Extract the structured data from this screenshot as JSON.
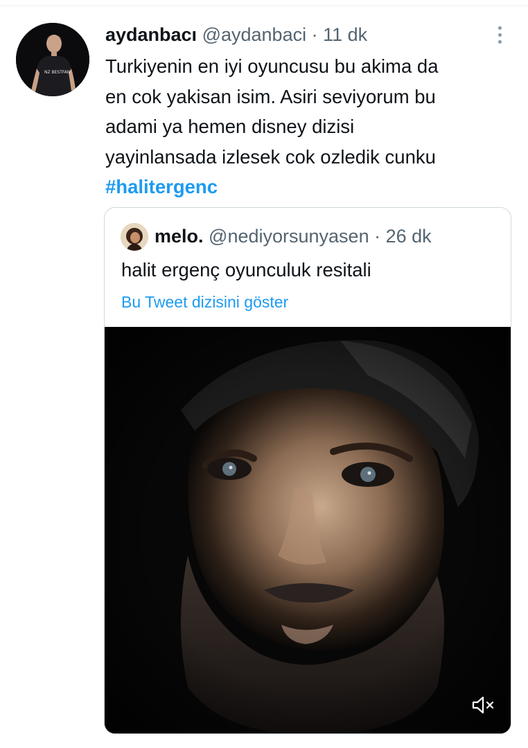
{
  "tweet": {
    "display_name": "aydanbacı",
    "handle": "@aydanbaci",
    "separator": "·",
    "time": "11 dk",
    "lines": [
      "Turkiyenin en iyi oyuncusu bu akima da",
      "en cok yakisan isim. Asiri seviyorum bu",
      "adami ya hemen disney dizisi",
      "yayinlansada izlesek cok ozledik cunku"
    ],
    "hashtag": "#halitergenc",
    "avatar_icon": "profile-avatar",
    "more_icon": "more-options-icon"
  },
  "quote": {
    "display_name": "melo.",
    "handle": "@nediyorsunyasen",
    "separator": "·",
    "time": "26 dk",
    "text": "halit ergenç oyunculuk resitali",
    "thread_link": "Bu Tweet dizisini göster",
    "media_icon": "video-thumbnail",
    "mute_icon": "volume-muted-icon"
  },
  "colors": {
    "link": "#1d9bf0",
    "secondary_text": "#536471",
    "primary_text": "#0f1419",
    "border": "#cfd9de"
  }
}
